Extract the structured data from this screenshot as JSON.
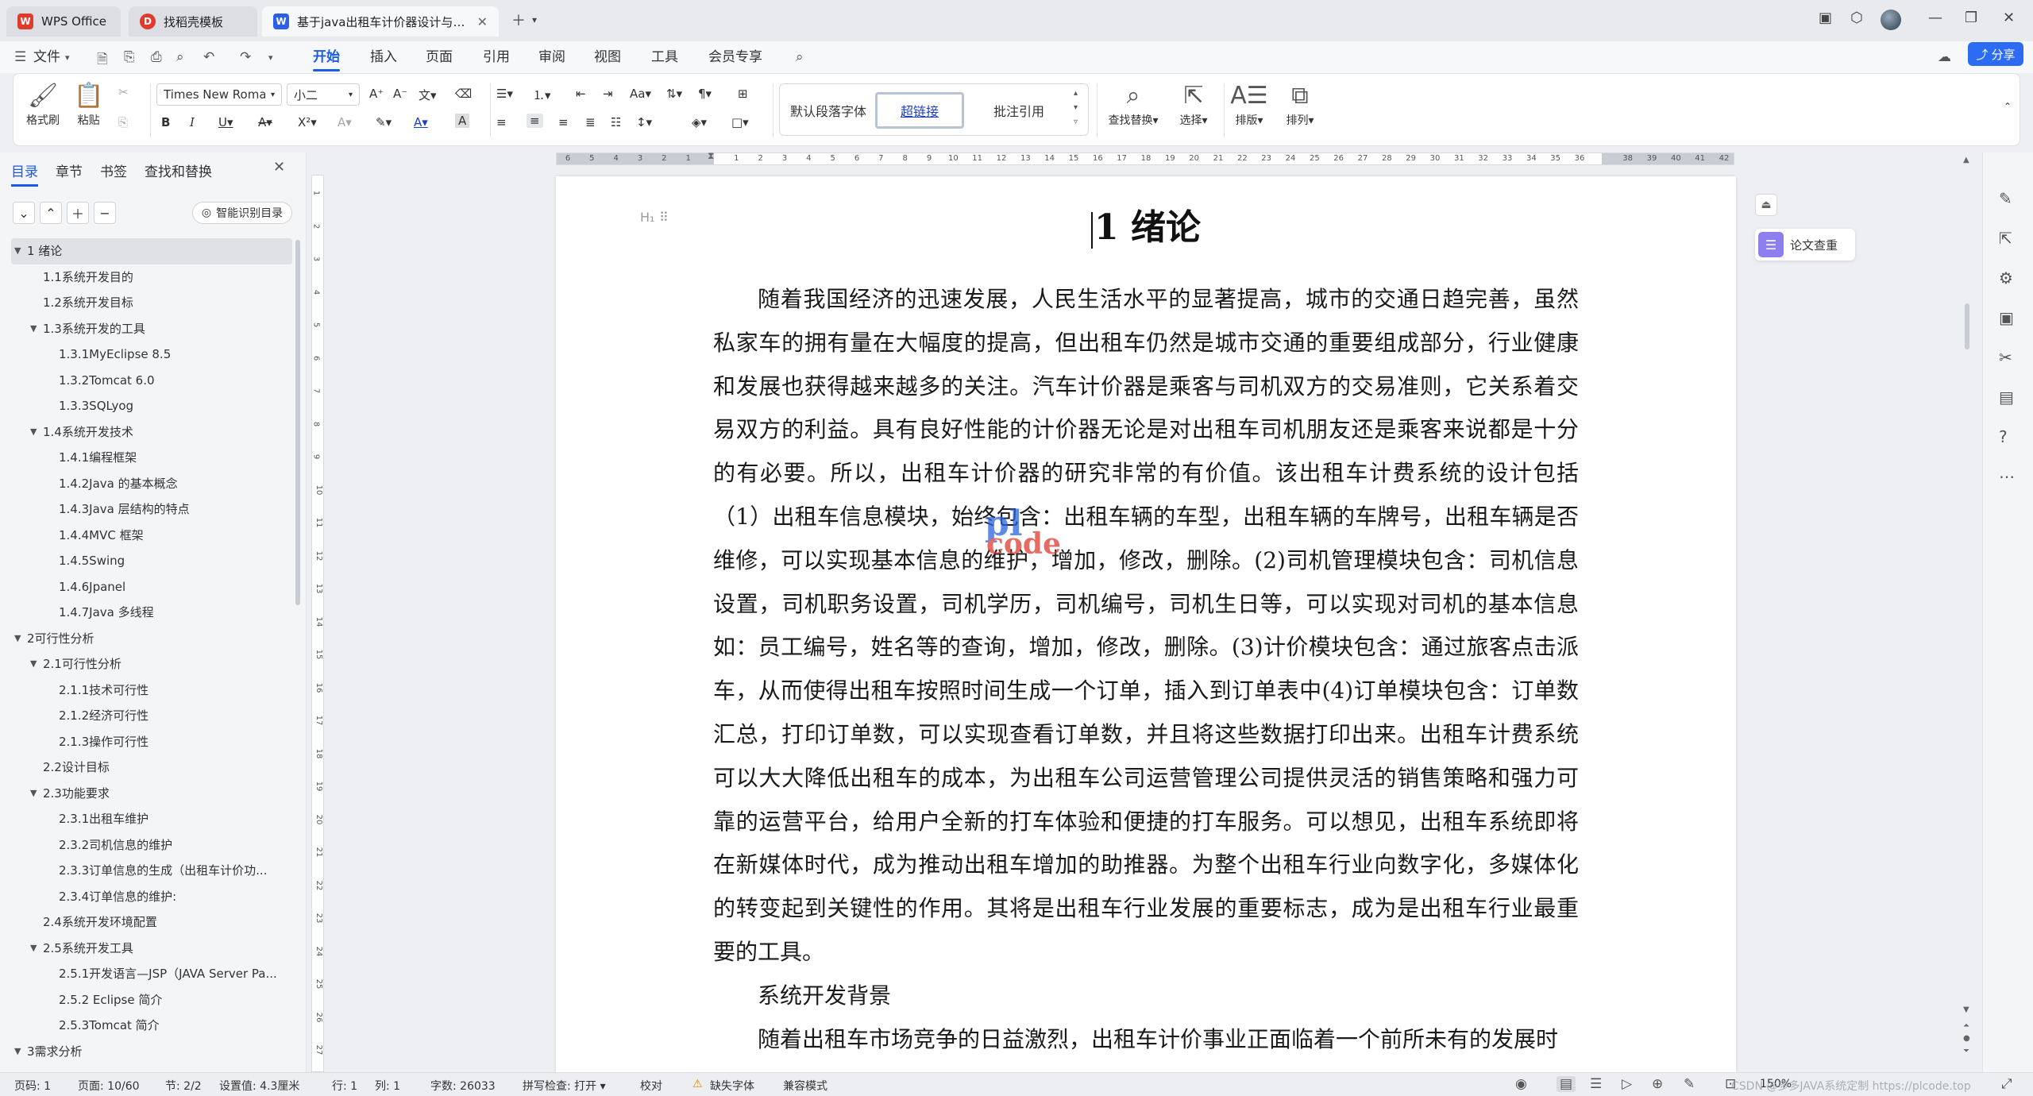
{
  "tabs": [
    {
      "label": "WPS Office",
      "logo": "W",
      "logo_color": "#e23b2e"
    },
    {
      "label": "找稻壳模板",
      "logo": "D",
      "logo_color": "#e23b2e"
    },
    {
      "label": "基于java出租车计价器设计与实现...",
      "logo": "W",
      "logo_color": "#2c5ee8"
    }
  ],
  "menu": {
    "file": "文件",
    "items": [
      "开始",
      "插入",
      "页面",
      "引用",
      "审阅",
      "视图",
      "工具",
      "会员专享"
    ],
    "active": "开始",
    "share": "分享"
  },
  "ribbon": {
    "format_brush": "格式刷",
    "paste": "粘贴",
    "font_name": "Times New Roman",
    "font_size": "小二",
    "styles": [
      "默认段落字体",
      "超链接",
      "批注引用"
    ],
    "selected_style": "超链接",
    "find_replace": "查找替换",
    "select": "选择",
    "layout": "排版",
    "arrange": "排列",
    "accent_color": "#1a5ce6"
  },
  "nav": {
    "tabs": [
      "目录",
      "章节",
      "书签",
      "查找和替换"
    ],
    "active_tab": "目录",
    "smart_toc": "智能识别目录",
    "toc": [
      {
        "level": 1,
        "label": "1 绪论",
        "expanded": true,
        "selected": true
      },
      {
        "level": 2,
        "label": "1.1系统开发目的"
      },
      {
        "level": 2,
        "label": "1.2系统开发目标"
      },
      {
        "level": 2,
        "label": "1.3系统开发的工具",
        "expanded": true
      },
      {
        "level": 3,
        "label": "1.3.1MyEclipse 8.5"
      },
      {
        "level": 3,
        "label": "1.3.2Tomcat 6.0"
      },
      {
        "level": 3,
        "label": "1.3.3SQLyog"
      },
      {
        "level": 2,
        "label": "1.4系统开发技术",
        "expanded": true
      },
      {
        "level": 3,
        "label": "1.4.1编程框架"
      },
      {
        "level": 3,
        "label": "1.4.2Java 的基本概念"
      },
      {
        "level": 3,
        "label": "1.4.3Java 层结构的特点"
      },
      {
        "level": 3,
        "label": "1.4.4MVC 框架"
      },
      {
        "level": 3,
        "label": "1.4.5Swing"
      },
      {
        "level": 3,
        "label": "1.4.6Jpanel"
      },
      {
        "level": 3,
        "label": "1.4.7Java 多线程"
      },
      {
        "level": 1,
        "label": "2可行性分析",
        "expanded": true
      },
      {
        "level": 2,
        "label": "2.1可行性分析",
        "expanded": true
      },
      {
        "level": 3,
        "label": "2.1.1技术可行性"
      },
      {
        "level": 3,
        "label": "2.1.2经济可行性"
      },
      {
        "level": 3,
        "label": "2.1.3操作可行性"
      },
      {
        "level": 2,
        "label": "2.2设计目标"
      },
      {
        "level": 2,
        "label": "2.3功能要求",
        "expanded": true
      },
      {
        "level": 3,
        "label": "2.3.1出租车维护"
      },
      {
        "level": 3,
        "label": "2.3.2司机信息的维护"
      },
      {
        "level": 3,
        "label": "2.3.3订单信息的生成（出租车计价功..."
      },
      {
        "level": 3,
        "label": "2.3.4订单信息的维护:"
      },
      {
        "level": 2,
        "label": "2.4系统开发环境配置"
      },
      {
        "level": 2,
        "label": "2.5系统开发工具",
        "expanded": true
      },
      {
        "level": 3,
        "label": "2.5.1开发语言—JSP（JAVA Server Pa..."
      },
      {
        "level": 3,
        "label": "2.5.2  Eclipse 简介"
      },
      {
        "level": 3,
        "label": "2.5.3Tomcat 简介"
      },
      {
        "level": 1,
        "label": "3需求分析",
        "expanded": true
      }
    ]
  },
  "document": {
    "heading": "1 绪论",
    "heading_handle": "H₁",
    "paragraphs": [
      "随着我国经济的迅速发展，人民生活水平的显著提高，城市的交通日趋完善，虽然私家车的拥有量在大幅度的提高，但出租车仍然是城市交通的重要组成部分，行业健康和发展也获得越来越多的关注。汽车计价器是乘客与司机双方的交易准则，它关系着交易双方的利益。具有良好性能的计价器无论是对出租车司机朋友还是乘客来说都是十分的有必要。所以，出租车计价器的研究非常的有价值。该出租车计费系统的设计包括（1）出租车信息模块，始终包含：出租车辆的车型，出租车辆的车牌号，出租车辆是否维修，可以实现基本信息的维护，增加，修改，删除。(2)司机管理模块包含：司机信息设置，司机职务设置，司机学历，司机编号，司机生日等，可以实现对司机的基本信息如：员工编号，姓名等的查询，增加，修改，删除。(3)计价模块包含：通过旅客点击派车，从而使得出租车按照时间生成一个订单，插入到订单表中(4)订单模块包含：订单数汇总，打印订单数，可以实现查看订单数，并且将这些数据打印出来。出租车计费系统可以大大降低出租车的成本，为出租车公司运营管理公司提供灵活的销售策略和强力可靠的运营平台，给用户全新的打车体验和便捷的打车服务。可以想见，出租车系统即将在新媒体时代，成为推动出租车增加的助推器。为整个出租车行业向数字化，多媒体化的转变起到关键性的作用。其将是出租车行业发展的重要标志，成为是出租车行业最重要的工具。"
    ],
    "subheading": "系统开发背景",
    "paragraph2": "随着出租车市场竞争的日益激烈，出租车计价事业正面临着一个前所未有的发展时",
    "watermark_top": "pl",
    "watermark_bottom": "code"
  },
  "right_panel": {
    "paper_check": "论文查重"
  },
  "status": {
    "page_num": "页码: 1",
    "pages": "页面: 10/60",
    "section": "节: 2/2",
    "setting": "设置值: 4.3厘米",
    "row": "行: 1",
    "col": "列: 1",
    "word_count": "字数: 26033",
    "spell_check": "拼写检查: 打开",
    "proofread": "校对",
    "missing_font": "缺失字体",
    "compat_mode": "兼容模式",
    "zoom": "150%",
    "watermark_text": "CSDN @多多JAVA系统定制 https://plcode.top"
  },
  "ruler": {
    "h_labels": [
      "6",
      "5",
      "4",
      "3",
      "2",
      "1",
      "",
      "1",
      "2",
      "3",
      "4",
      "5",
      "6",
      "7",
      "8",
      "9",
      "10",
      "11",
      "12",
      "13",
      "14",
      "15",
      "16",
      "17",
      "18",
      "19",
      "20",
      "21",
      "22",
      "23",
      "24",
      "25",
      "26",
      "27",
      "28",
      "29",
      "30",
      "31",
      "32",
      "33",
      "34",
      "35",
      "36",
      "",
      "38",
      "39",
      "40",
      "41",
      "42"
    ],
    "v_labels": [
      "1",
      "2",
      "3",
      "4",
      "5",
      "6",
      "7",
      "8",
      "9",
      "10",
      "11",
      "12",
      "13",
      "14",
      "15",
      "16",
      "17",
      "18",
      "19",
      "20",
      "21",
      "22",
      "23",
      "24",
      "25",
      "26",
      "27"
    ]
  }
}
